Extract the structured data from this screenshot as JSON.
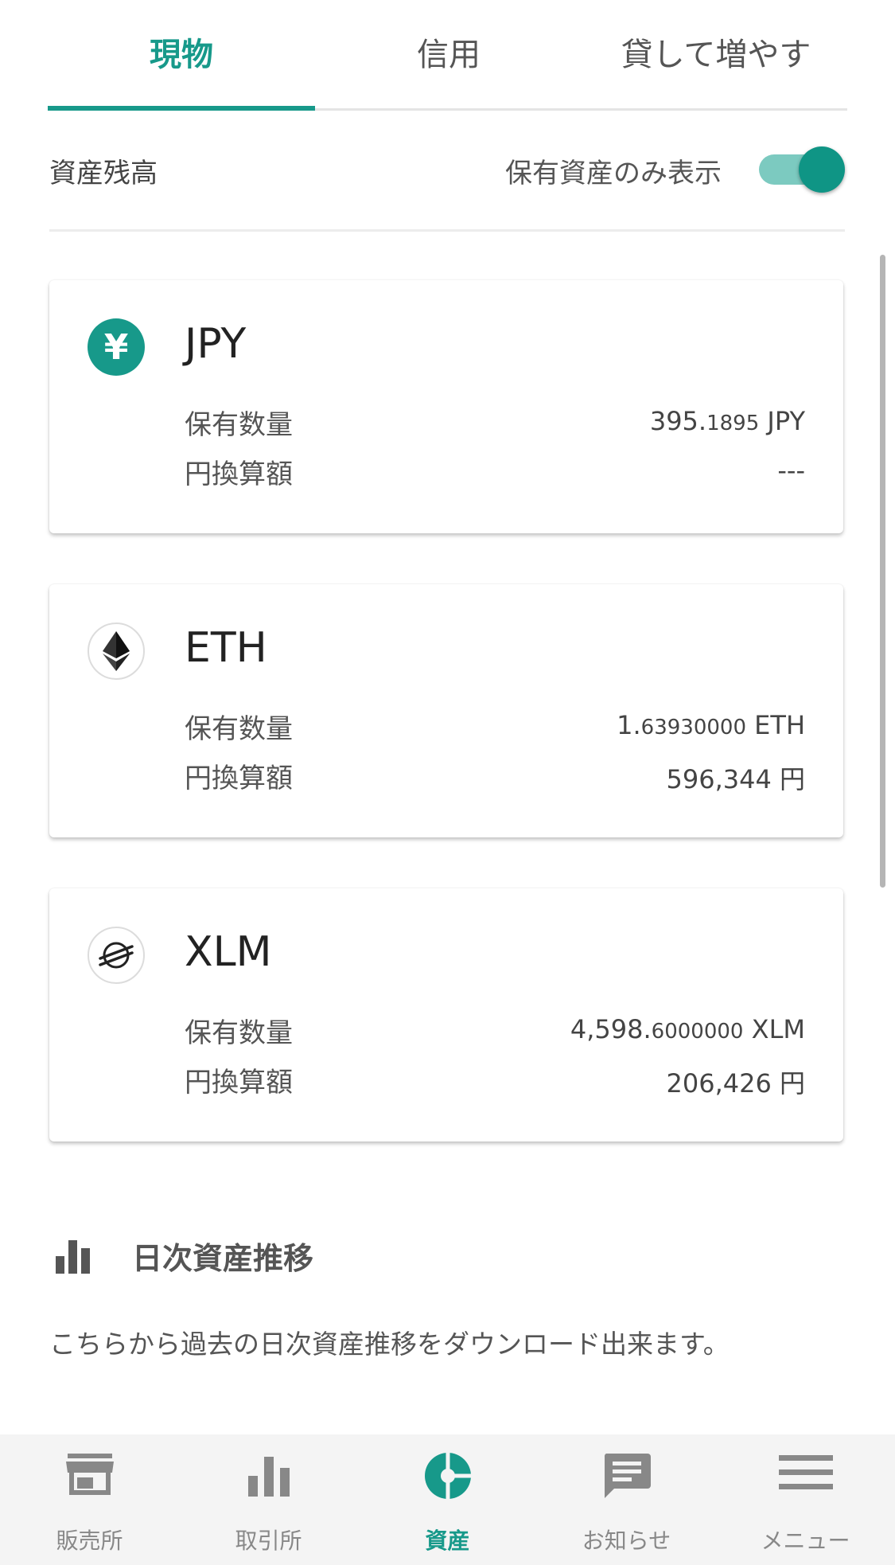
{
  "tabs": [
    {
      "label": "現物",
      "active": true
    },
    {
      "label": "信用",
      "active": false
    },
    {
      "label": "貸して増やす",
      "active": false
    }
  ],
  "balance": {
    "title": "資産残高",
    "toggle_label": "保有資産のみ表示",
    "toggle_on": true
  },
  "assets": [
    {
      "name": "JPY",
      "icon": "yen-icon",
      "icon_glyph": "¥",
      "holding_label": "保有数量",
      "holding_main": "395.",
      "holding_small": "1895",
      "holding_unit": " JPY",
      "yen_label": "円換算額",
      "yen_value": "---"
    },
    {
      "name": "ETH",
      "icon": "ethereum-icon",
      "holding_label": "保有数量",
      "holding_main": "1.",
      "holding_small": "63930000",
      "holding_unit": " ETH",
      "yen_label": "円換算額",
      "yen_value": "596,344 円"
    },
    {
      "name": "XLM",
      "icon": "stellar-icon",
      "holding_label": "保有数量",
      "holding_main": "4,598.",
      "holding_small": "6000000",
      "holding_unit": " XLM",
      "yen_label": "円換算額",
      "yen_value": "206,426 円"
    }
  ],
  "daily": {
    "title": "日次資産推移",
    "description": "こちらから過去の日次資産推移をダウンロード出来ます。"
  },
  "nav": [
    {
      "label": "販売所",
      "icon": "store-icon",
      "active": false
    },
    {
      "label": "取引所",
      "icon": "bar-chart-icon",
      "active": false
    },
    {
      "label": "資産",
      "icon": "pie-chart-icon",
      "active": true
    },
    {
      "label": "お知らせ",
      "icon": "message-icon",
      "active": false
    },
    {
      "label": "メニュー",
      "icon": "menu-icon",
      "active": false
    }
  ],
  "colors": {
    "accent": "#17998a",
    "toggle_track": "#7ccac0",
    "nav_inactive": "#888888",
    "nav_background": "#f4f4f4"
  }
}
